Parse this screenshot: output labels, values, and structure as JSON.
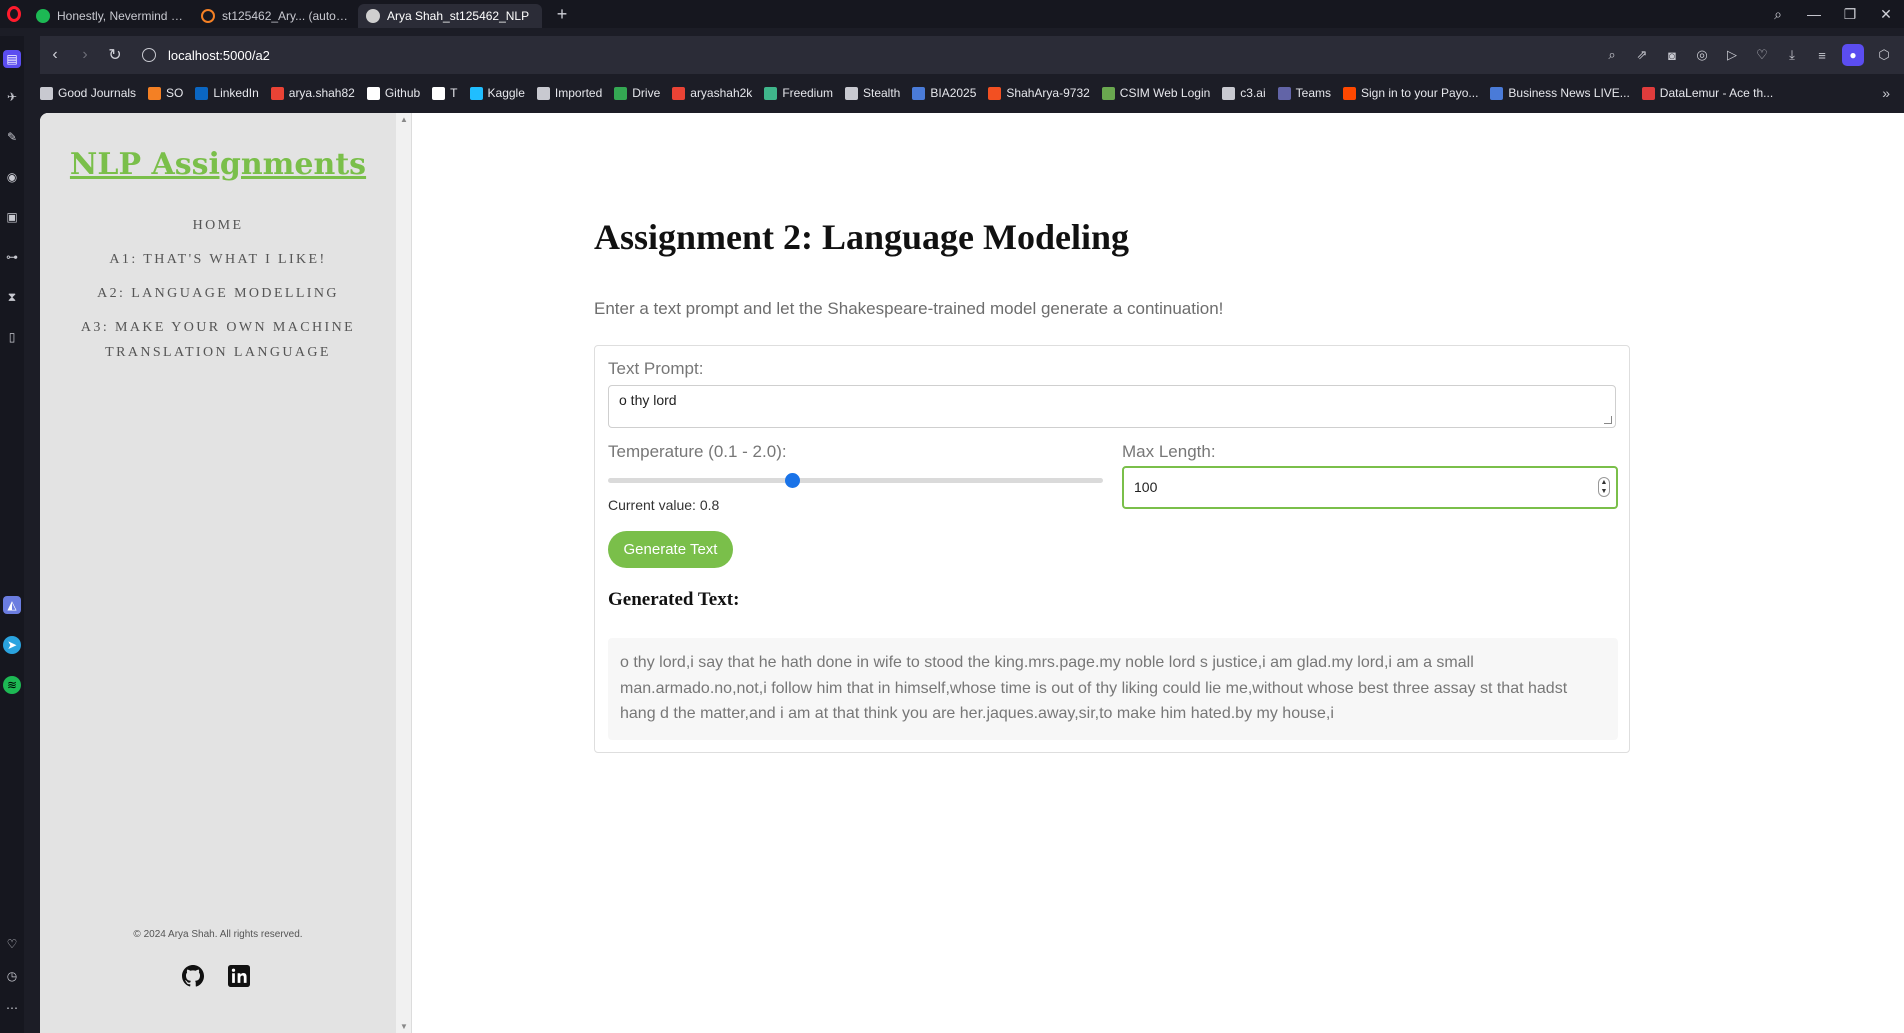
{
  "browser": {
    "tabs": [
      {
        "label": "Honestly, Nevermind - Al",
        "color": "#1db954"
      },
      {
        "label": "st125462_Ary... (auto-k) -",
        "color": "#f48024"
      },
      {
        "label": "Arya Shah_st125462_NLP",
        "color": "#cfcfcf"
      }
    ],
    "url": "localhost:5000/a2",
    "bookmarks": [
      {
        "label": "Good Journals",
        "icon": "folder-icon",
        "color": "#c8c9d0"
      },
      {
        "label": "SO",
        "icon": "stackoverflow-icon",
        "color": "#f48024"
      },
      {
        "label": "LinkedIn",
        "icon": "linkedin-icon",
        "color": "#0a66c2"
      },
      {
        "label": "arya.shah82",
        "icon": "gmail-icon",
        "color": "#ea4335"
      },
      {
        "label": "Github",
        "icon": "github-icon",
        "color": "#ffffff"
      },
      {
        "label": "T",
        "icon": "x-icon",
        "color": "#ffffff"
      },
      {
        "label": "Kaggle",
        "icon": "kaggle-icon",
        "color": "#20beff"
      },
      {
        "label": "Imported",
        "icon": "folder-icon",
        "color": "#c8c9d0"
      },
      {
        "label": "Drive",
        "icon": "drive-icon",
        "color": "#34a853"
      },
      {
        "label": "aryashah2k",
        "icon": "gmail-icon",
        "color": "#ea4335"
      },
      {
        "label": "Freedium",
        "icon": "freedium-icon",
        "color": "#3fb68b"
      },
      {
        "label": "Stealth",
        "icon": "stealth-icon",
        "color": "#c8c9d0"
      },
      {
        "label": "BIA2025",
        "icon": "bia-icon",
        "color": "#4a7bd8"
      },
      {
        "label": "ShahArya-9732",
        "icon": "microsoft-icon",
        "color": "#f25022"
      },
      {
        "label": "CSIM Web Login",
        "icon": "csim-icon",
        "color": "#6aa84f"
      },
      {
        "label": "c3.ai",
        "icon": "c3-icon",
        "color": "#c8c9d0"
      },
      {
        "label": "Teams",
        "icon": "teams-icon",
        "color": "#6264a7"
      },
      {
        "label": "Sign in to your Payo...",
        "icon": "payoneer-icon",
        "color": "#ff4800"
      },
      {
        "label": "Business News LIVE...",
        "icon": "news-icon",
        "color": "#4a7bd8"
      },
      {
        "label": "DataLemur - Ace th...",
        "icon": "datalemur-icon",
        "color": "#e03c3c"
      }
    ]
  },
  "site": {
    "title": "NLP Assignments",
    "nav": [
      "HOME",
      "A1: THAT'S WHAT I LIKE!",
      "A2: LANGUAGE MODELLING",
      "A3: MAKE YOUR OWN MACHINE TRANSLATION LANGUAGE"
    ],
    "footer": "© 2024 Arya Shah. All rights reserved.",
    "accent": "#7abf4a"
  },
  "main": {
    "heading": "Assignment 2: Language Modeling",
    "intro": "Enter a text prompt and let the Shakespeare-trained model generate a continuation!",
    "prompt_label": "Text Prompt:",
    "prompt_value": "o thy lord",
    "temperature_label": "Temperature (0.1 - 2.0):",
    "temperature": {
      "min": 0.1,
      "max": 2.0,
      "value": 0.8
    },
    "current_value": "Current value: 0.8",
    "max_length_label": "Max Length:",
    "max_length_value": "100",
    "generate_label": "Generate Text",
    "generated_title": "Generated Text:",
    "generated_text": "o thy lord,i say that he hath done in wife to stood the king.mrs.page.my noble lord s justice,i am glad.my lord,i am a small man.armado.no,not,i follow him that in himself,whose time is out of thy liking could lie me,without whose best three assay st that hadst hang d the matter,and i am at that think you are her.jaques.away,sir,to make him hated.by my house,i"
  }
}
